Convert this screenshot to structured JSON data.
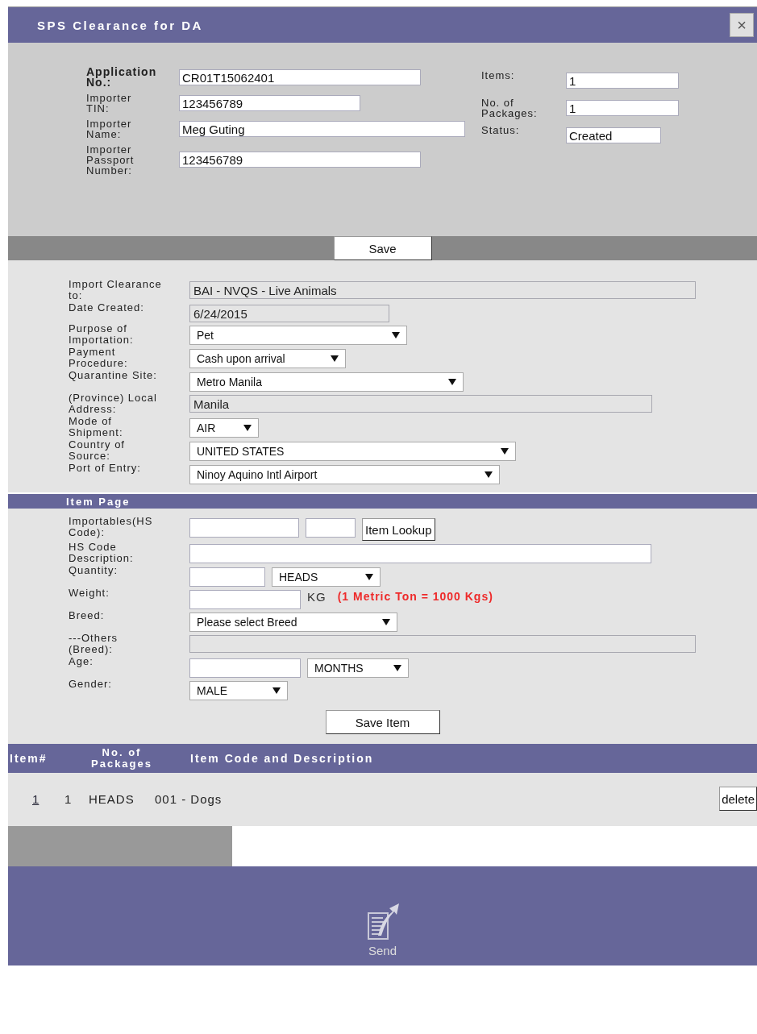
{
  "dialog": {
    "title": "SPS Clearance for DA",
    "close": "×"
  },
  "header": {
    "left": [
      {
        "label": "Application No.:",
        "value": "CR01T15062401",
        "bold": true
      },
      {
        "label": "Importer TIN:",
        "value": "123456789",
        "bold": false
      },
      {
        "label": "Importer Name:",
        "value": "Meg Guting",
        "bold": false
      },
      {
        "label": "Importer Passport Number:",
        "value": "123456789",
        "bold": false
      }
    ],
    "right": [
      {
        "label": "Items:",
        "value": "1"
      },
      {
        "label": "No. of Packages:",
        "value": "1"
      },
      {
        "label": "Status:",
        "value": "Created"
      }
    ],
    "save_button": "Save"
  },
  "details": {
    "rows": [
      {
        "label": "Import Clearance to:",
        "kind": "readonly",
        "value": "BAI - NVQS - Live Animals"
      },
      {
        "label": "Date Created:",
        "kind": "readonly",
        "value": "6/24/2015"
      },
      {
        "label": "Purpose of Importation:",
        "kind": "select",
        "value": "Pet"
      },
      {
        "label": "Payment Procedure:",
        "kind": "select",
        "value": "Cash upon arrival"
      },
      {
        "label": "Quarantine Site:",
        "kind": "select",
        "value": "Metro Manila"
      },
      {
        "label": "(Province) Local Address:",
        "kind": "readonly",
        "value": "Manila"
      },
      {
        "label": "Mode of Shipment:",
        "kind": "select",
        "value": "AIR"
      },
      {
        "label": "Country of Source:",
        "kind": "select",
        "value": "UNITED STATES"
      },
      {
        "label": "Port of Entry:",
        "kind": "select",
        "value": "Ninoy Aquino Intl Airport"
      }
    ]
  },
  "item_page": {
    "title": "Item Page",
    "rows": [
      {
        "label": "Importables(HS Code):",
        "kind": "lookup",
        "button": "Item Lookup"
      },
      {
        "label": "HS Code Description:",
        "kind": "input"
      },
      {
        "label": "Quantity:",
        "kind": "input_select",
        "value": "HEADS"
      },
      {
        "label": "Weight:",
        "kind": "input_unit",
        "unit": "KG",
        "note": "(1 Metric Ton = 1000 Kgs)"
      },
      {
        "label": "Breed:",
        "kind": "select",
        "value": "Please select Breed"
      },
      {
        "label": "---Others (Breed):",
        "kind": "readonly"
      },
      {
        "label": "Age:",
        "kind": "input_select",
        "value": "MONTHS"
      },
      {
        "label": "Gender:",
        "kind": "select",
        "value": "MALE"
      }
    ],
    "save_button": "Save Item"
  },
  "items_table": {
    "columns": [
      "Item#",
      "No. of Packages",
      "Item Code and Description"
    ],
    "rows": [
      {
        "item": "1",
        "packages": "1",
        "unit": "HEADS",
        "description": "001 - Dogs",
        "action": "delete"
      }
    ]
  },
  "footer": {
    "send": "Send"
  }
}
